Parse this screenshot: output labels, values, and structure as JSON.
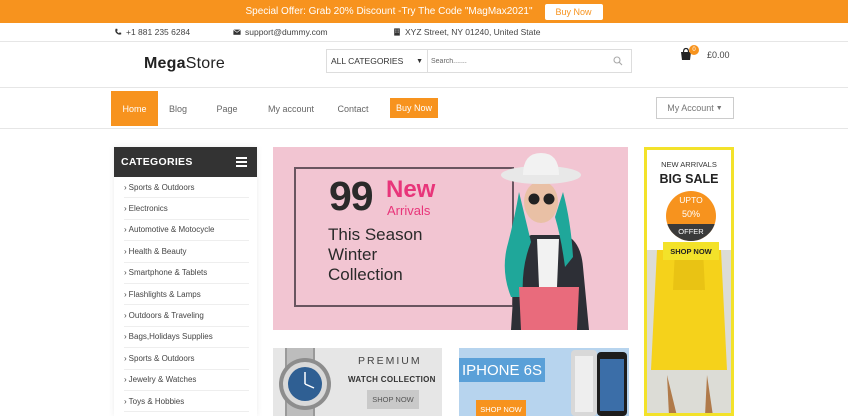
{
  "offer_bar": {
    "text": "Special Offer: Grab 20% Discount -Try The Code \"MagMax2021\"",
    "button": "Buy Now"
  },
  "contact": {
    "phone": "+1 881 235 6284",
    "email": "support@dummy.com",
    "address": "XYZ Street, NY 01240, United State"
  },
  "header": {
    "logo_bold": "Mega",
    "logo_light": "Store",
    "category_select": "ALL CATEGORIES",
    "search_placeholder": "Search.......",
    "cart_count": "0",
    "cart_total": "£0.00"
  },
  "nav": {
    "items": [
      "Home",
      "Blog",
      "Page",
      "My account",
      "Contact"
    ],
    "buy_now": "Buy Now",
    "my_account_dropdown": "My Account"
  },
  "categories": {
    "title": "CATEGORIES",
    "items": [
      "Sports & Outdoors",
      "Electronics",
      "Automotive & Motocycle",
      "Health & Beauty",
      "Smartphone & Tablets",
      "Flashlights & Lamps",
      "Outdoors & Traveling",
      "Bags,Holidays Supplies",
      "Sports & Outdoors",
      "Jewelry & Watches",
      "Toys & Hobbies"
    ]
  },
  "hero": {
    "number": "99",
    "new": "New",
    "arrivals": "Arrivals",
    "line1": "This Season",
    "line2": "Winter",
    "line3": "Collection"
  },
  "side_promo": {
    "new_arrivals": "NEW ARRIVALS",
    "big_sale": "BIG SALE",
    "upto": "UPTO",
    "percent": "50%",
    "offer": "OFFER",
    "button": "SHOP NOW"
  },
  "watch_banner": {
    "premium": "PREMIUM",
    "collection": "WATCH COLLECTION",
    "button": "SHOP NOW"
  },
  "phone_banner": {
    "title": "IPHONE 6S",
    "button": "SHOP NOW"
  },
  "colors": {
    "accent": "#f7931e",
    "dark": "#333333",
    "promo_yellow": "#f3e22a",
    "hero_pink": "#f2c5d2",
    "hero_magenta": "#e8357a"
  }
}
